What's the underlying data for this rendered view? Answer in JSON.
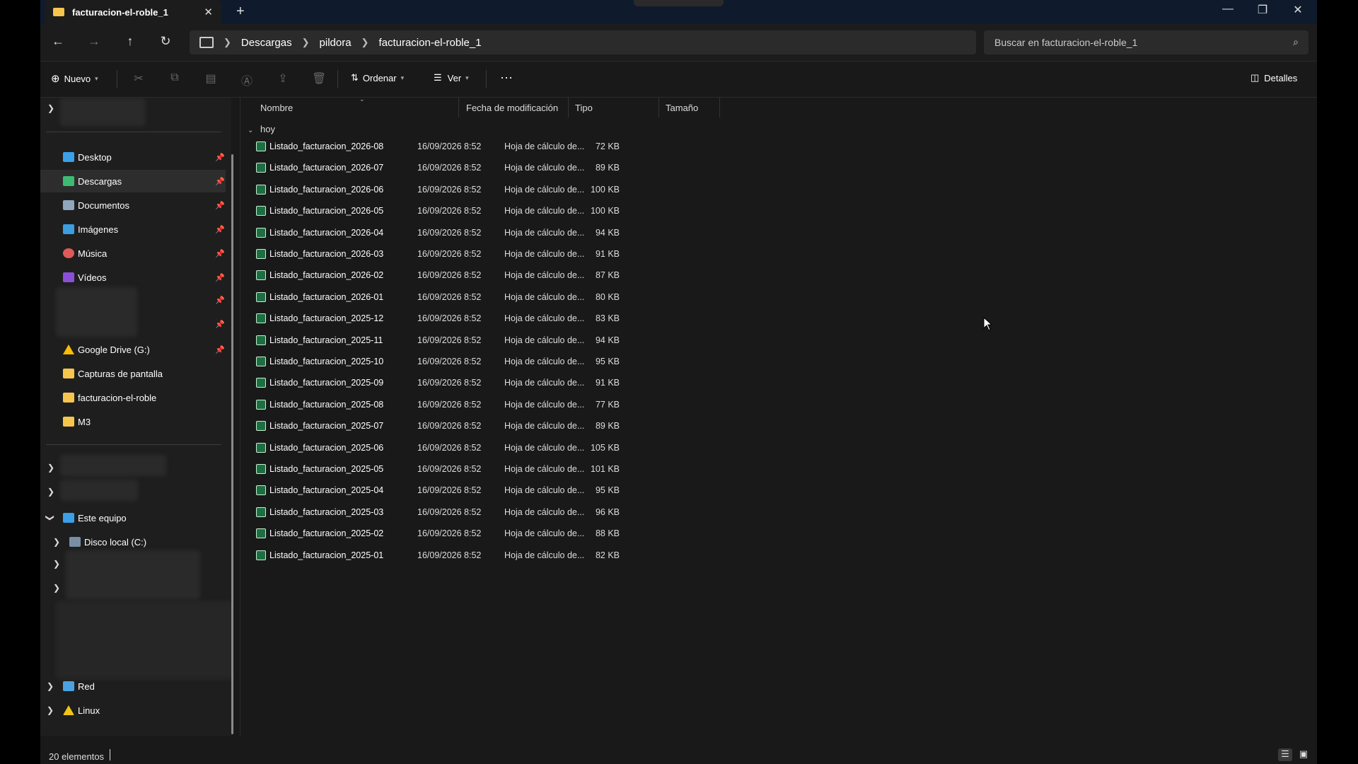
{
  "titlebar": {
    "tab_label": "facturacion-el-roble_1",
    "newtab_glyph": "+",
    "close_glyph": "✕",
    "controls": [
      "—",
      "❐",
      "✕"
    ]
  },
  "nav": {
    "breadcrumbs": [
      "Descargas",
      "pildora",
      "facturacion-el-roble_1"
    ],
    "search_placeholder": "Buscar en facturacion-el-roble_1"
  },
  "toolbar": {
    "new_label": "Nuevo",
    "sort_label": "Ordenar",
    "view_label": "Ver",
    "more_label": "···",
    "details_label": "Detalles"
  },
  "sidebar": {
    "quick_access": [
      {
        "label": "Desktop",
        "icon": "desktop-icon",
        "color": "#3aa0e8",
        "pinned": true,
        "selected": false
      },
      {
        "label": "Descargas",
        "icon": "download-icon",
        "color": "#3dbb74",
        "pinned": true,
        "selected": true
      },
      {
        "label": "Documentos",
        "icon": "document-icon",
        "color": "#8fa6bd",
        "pinned": true,
        "selected": false
      },
      {
        "label": "Imágenes",
        "icon": "picture-icon",
        "color": "#3c9de0",
        "pinned": true,
        "selected": false
      },
      {
        "label": "Música",
        "icon": "music-icon",
        "color": "#e05a5a",
        "pinned": true,
        "selected": false
      },
      {
        "label": "Vídeos",
        "icon": "video-icon",
        "color": "#8a4fd6",
        "pinned": true,
        "selected": false
      }
    ],
    "more_items": [
      {
        "label": "Google Drive (G:)",
        "icon": "google-drive-icon",
        "color": "#fbbc04",
        "pinned": true
      },
      {
        "label": "Capturas de pantalla",
        "icon": "folder-icon",
        "color": "#f6c54e",
        "pinned": false
      },
      {
        "label": "facturacion-el-roble",
        "icon": "folder-icon",
        "color": "#f6c54e",
        "pinned": false
      },
      {
        "label": "M3",
        "icon": "folder-icon",
        "color": "#f6c54e",
        "pinned": false
      }
    ],
    "this_pc": "Este equipo",
    "local_disk": "Disco local (C:)",
    "network": "Red",
    "linux": "Linux"
  },
  "columns": {
    "name": "Nombre",
    "modified": "Fecha de modificación",
    "type": "Tipo",
    "size": "Tamaño"
  },
  "group_label": "hoy",
  "files": [
    {
      "name": "Listado_facturacion_2026-08",
      "date": "16/09/2026 8:52",
      "type": "Hoja de cálculo de...",
      "size": "72 KB"
    },
    {
      "name": "Listado_facturacion_2026-07",
      "date": "16/09/2026 8:52",
      "type": "Hoja de cálculo de...",
      "size": "89 KB"
    },
    {
      "name": "Listado_facturacion_2026-06",
      "date": "16/09/2026 8:52",
      "type": "Hoja de cálculo de...",
      "size": "100 KB"
    },
    {
      "name": "Listado_facturacion_2026-05",
      "date": "16/09/2026 8:52",
      "type": "Hoja de cálculo de...",
      "size": "100 KB"
    },
    {
      "name": "Listado_facturacion_2026-04",
      "date": "16/09/2026 8:52",
      "type": "Hoja de cálculo de...",
      "size": "94 KB"
    },
    {
      "name": "Listado_facturacion_2026-03",
      "date": "16/09/2026 8:52",
      "type": "Hoja de cálculo de...",
      "size": "91 KB"
    },
    {
      "name": "Listado_facturacion_2026-02",
      "date": "16/09/2026 8:52",
      "type": "Hoja de cálculo de...",
      "size": "87 KB"
    },
    {
      "name": "Listado_facturacion_2026-01",
      "date": "16/09/2026 8:52",
      "type": "Hoja de cálculo de...",
      "size": "80 KB"
    },
    {
      "name": "Listado_facturacion_2025-12",
      "date": "16/09/2026 8:52",
      "type": "Hoja de cálculo de...",
      "size": "83 KB"
    },
    {
      "name": "Listado_facturacion_2025-11",
      "date": "16/09/2026 8:52",
      "type": "Hoja de cálculo de...",
      "size": "94 KB"
    },
    {
      "name": "Listado_facturacion_2025-10",
      "date": "16/09/2026 8:52",
      "type": "Hoja de cálculo de...",
      "size": "95 KB"
    },
    {
      "name": "Listado_facturacion_2025-09",
      "date": "16/09/2026 8:52",
      "type": "Hoja de cálculo de...",
      "size": "91 KB"
    },
    {
      "name": "Listado_facturacion_2025-08",
      "date": "16/09/2026 8:52",
      "type": "Hoja de cálculo de...",
      "size": "77 KB"
    },
    {
      "name": "Listado_facturacion_2025-07",
      "date": "16/09/2026 8:52",
      "type": "Hoja de cálculo de...",
      "size": "89 KB"
    },
    {
      "name": "Listado_facturacion_2025-06",
      "date": "16/09/2026 8:52",
      "type": "Hoja de cálculo de...",
      "size": "105 KB"
    },
    {
      "name": "Listado_facturacion_2025-05",
      "date": "16/09/2026 8:52",
      "type": "Hoja de cálculo de...",
      "size": "101 KB"
    },
    {
      "name": "Listado_facturacion_2025-04",
      "date": "16/09/2026 8:52",
      "type": "Hoja de cálculo de...",
      "size": "95 KB"
    },
    {
      "name": "Listado_facturacion_2025-03",
      "date": "16/09/2026 8:52",
      "type": "Hoja de cálculo de...",
      "size": "96 KB"
    },
    {
      "name": "Listado_facturacion_2025-02",
      "date": "16/09/2026 8:52",
      "type": "Hoja de cálculo de...",
      "size": "88 KB"
    },
    {
      "name": "Listado_facturacion_2025-01",
      "date": "16/09/2026 8:52",
      "type": "Hoja de cálculo de...",
      "size": "82 KB"
    }
  ],
  "status": {
    "count_label": "20 elementos"
  },
  "colors": {
    "accent": "#0078d4",
    "excel_green": "#1d6f42",
    "folder_yellow": "#f6c54e",
    "background": "#191919"
  }
}
